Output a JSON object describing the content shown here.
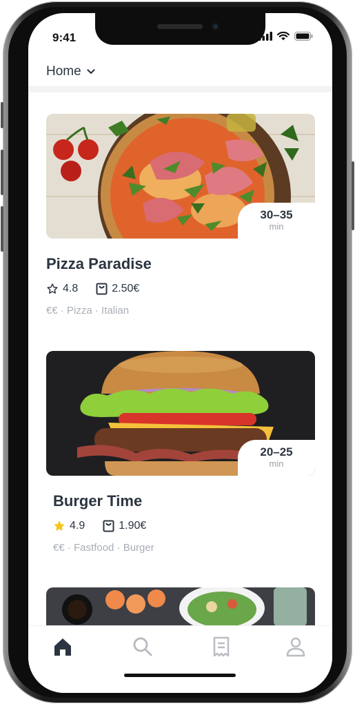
{
  "status_bar": {
    "time": "9:41"
  },
  "header": {
    "location_label": "Home"
  },
  "restaurants": [
    {
      "name": "Pizza Paradise",
      "eta_range": "30–35",
      "eta_unit": "min",
      "rating": "4.8",
      "rating_icon": "star-outline-icon",
      "delivery_fee": "2.50€",
      "price_level": "€€",
      "tags": "€€ · Pizza · Italian"
    },
    {
      "name": "Burger Time",
      "eta_range": "20–25",
      "eta_unit": "min",
      "rating": "4.9",
      "rating_icon": "star-filled-icon",
      "delivery_fee": "1.90€",
      "price_level": "€€",
      "tags": "€€ · Fastfood · Burger"
    }
  ],
  "bottom_nav": [
    {
      "name": "home",
      "icon": "home-icon",
      "active": true
    },
    {
      "name": "search",
      "icon": "search-icon",
      "active": false
    },
    {
      "name": "orders",
      "icon": "receipt-icon",
      "active": false
    },
    {
      "name": "profile",
      "icon": "user-icon",
      "active": false
    }
  ],
  "colors": {
    "text_primary": "#2b3440",
    "text_muted": "#a8adb5",
    "star_gold": "#f5c518",
    "nav_active": "#2b3440",
    "nav_inactive": "#b9bcc2"
  }
}
